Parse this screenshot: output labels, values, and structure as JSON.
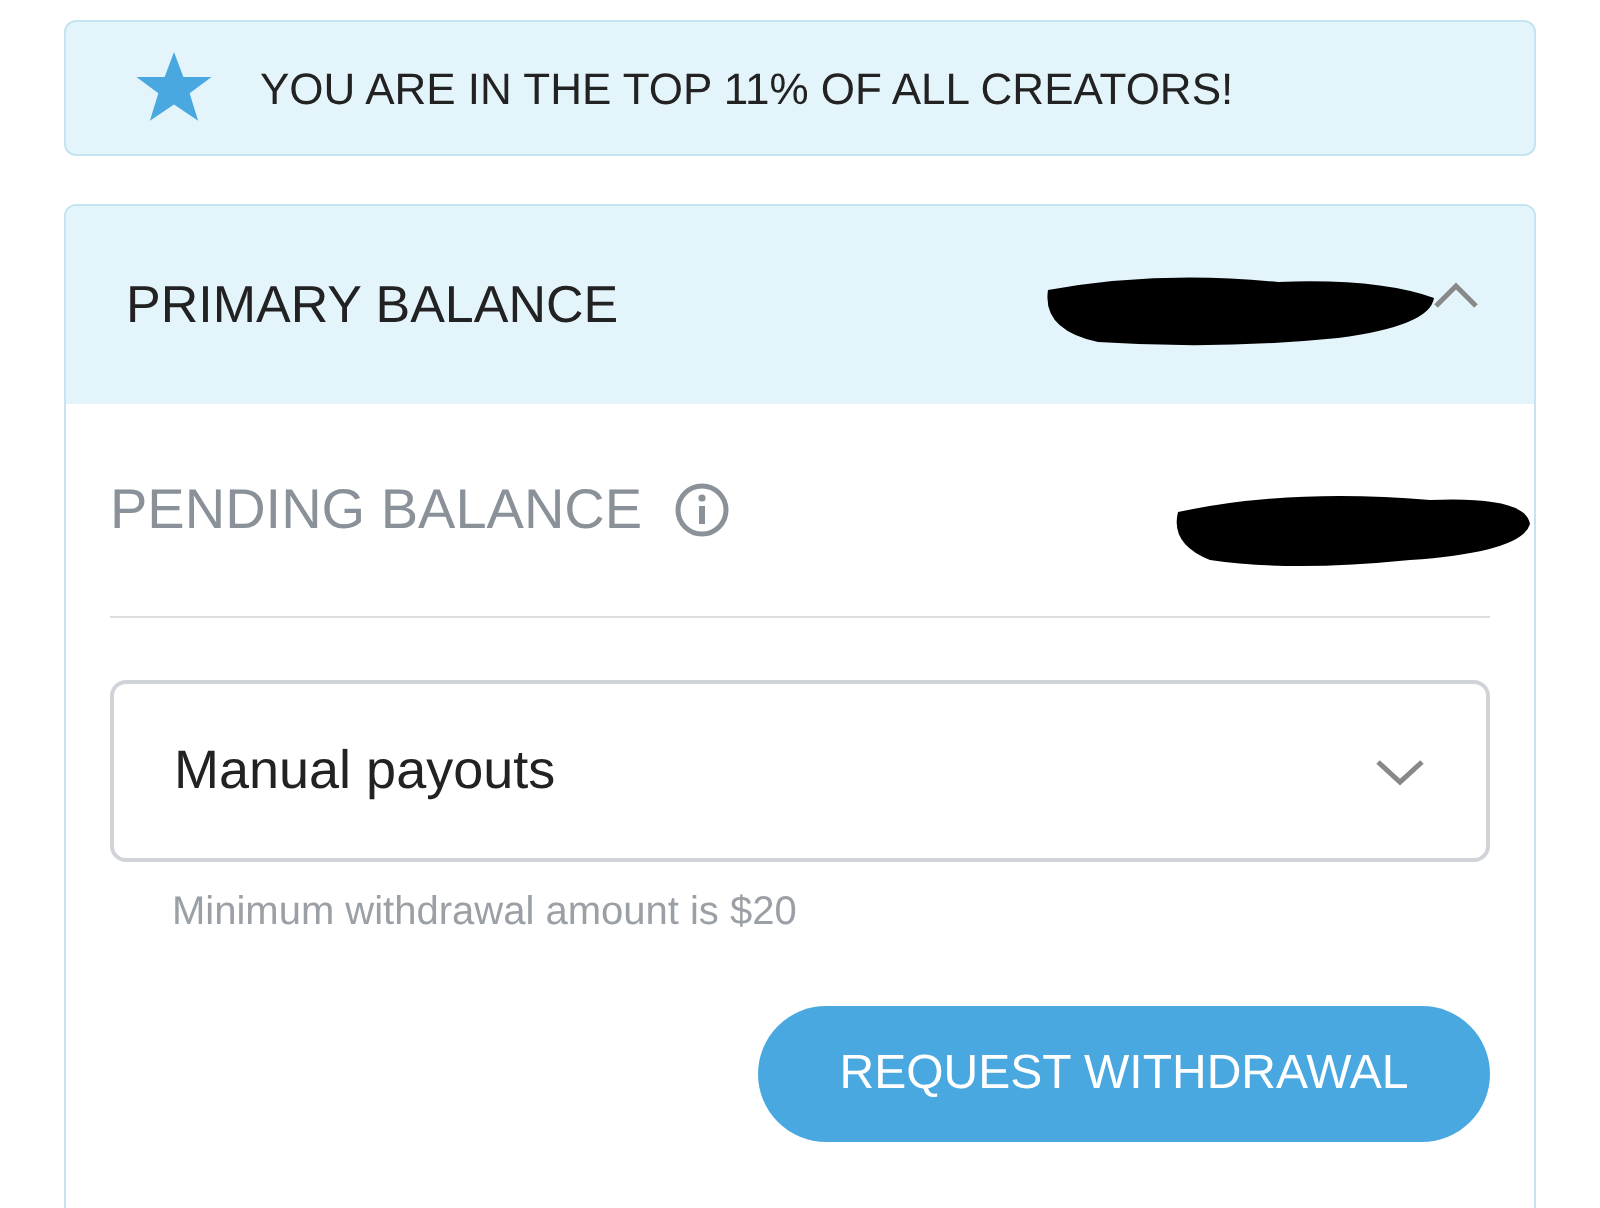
{
  "banner": {
    "text": "YOU ARE IN THE TOP 11% OF ALL CREATORS!"
  },
  "primary_balance": {
    "label": "PRIMARY BALANCE",
    "expanded": true
  },
  "pending_balance": {
    "label": "PENDING BALANCE"
  },
  "payout_select": {
    "value": "Manual payouts"
  },
  "hint": "Minimum withdrawal amount is $20",
  "button": "REQUEST WITHDRAWAL"
}
